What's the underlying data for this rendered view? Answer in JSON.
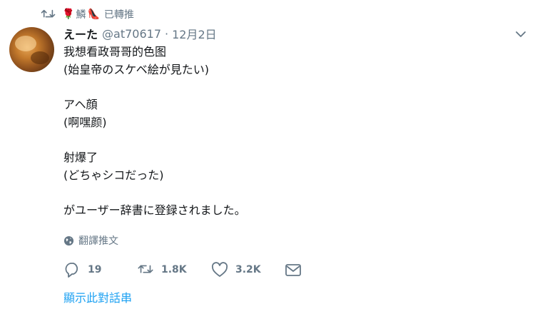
{
  "retweet_context": {
    "emoji_rose": "🌹",
    "name": "鱗",
    "emoji_heel": "👠",
    "label": "已轉推"
  },
  "tweet": {
    "display_name": "えーた",
    "handle": "@at70617",
    "separator": "·",
    "date": "12月2日",
    "text_lines": [
      "我想看政哥哥的色图",
      "(始皇帝のスケベ絵が見たい)",
      "",
      "アヘ顔",
      "(啊嘿颜)",
      "",
      "射爆了",
      "(どちゃシコだった)",
      "",
      "がユーザー辞書に登録されました。"
    ],
    "translate_label": "翻譯推文"
  },
  "actions": {
    "reply_count": "19",
    "retweet_count": "1.8K",
    "like_count": "3.2K"
  },
  "show_thread_label": "顯示此對話串",
  "colors": {
    "text_primary": "#14171a",
    "text_secondary": "#657786",
    "link": "#1da1f2"
  },
  "icons": [
    "retweet-icon",
    "chevron-down-icon",
    "globe-icon",
    "reply-icon",
    "retweet-icon",
    "heart-icon",
    "envelope-icon"
  ]
}
